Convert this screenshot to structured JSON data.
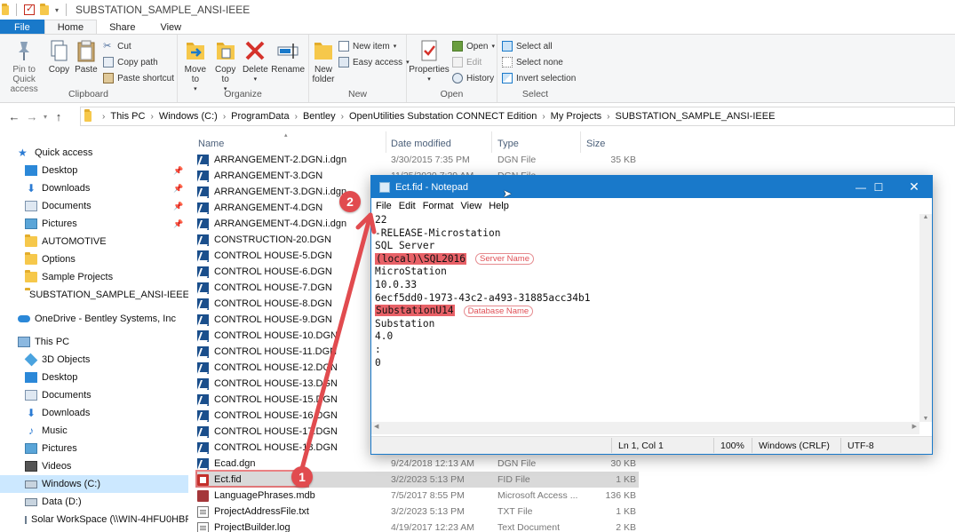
{
  "window": {
    "title": "SUBSTATION_SAMPLE_ANSI-IEEE"
  },
  "ribbon": {
    "tabs": [
      "File",
      "Home",
      "Share",
      "View"
    ],
    "clipboard": {
      "pin_label": "Pin to Quick access",
      "copy_label": "Copy",
      "paste_label": "Paste",
      "cut_label": "Cut",
      "copy_path_label": "Copy path",
      "paste_shortcut_label": "Paste shortcut",
      "group_label": "Clipboard"
    },
    "organize": {
      "move_to_label": "Move to",
      "copy_to_label": "Copy to",
      "delete_label": "Delete",
      "rename_label": "Rename",
      "group_label": "Organize"
    },
    "new": {
      "new_folder_label": "New folder",
      "new_item_label": "New item",
      "easy_access_label": "Easy access",
      "group_label": "New"
    },
    "open": {
      "properties_label": "Properties",
      "open_label": "Open",
      "edit_label": "Edit",
      "history_label": "History",
      "group_label": "Open"
    },
    "select": {
      "select_all_label": "Select all",
      "select_none_label": "Select none",
      "invert_label": "Invert selection",
      "group_label": "Select"
    }
  },
  "address": {
    "crumbs": [
      "This PC",
      "Windows (C:)",
      "ProgramData",
      "Bentley",
      "OpenUtilities Substation CONNECT Edition",
      "My Projects",
      "SUBSTATION_SAMPLE_ANSI-IEEE"
    ]
  },
  "sidebar": {
    "quick_access": "Quick access",
    "qa_items": [
      "Desktop",
      "Downloads",
      "Documents",
      "Pictures",
      "AUTOMOTIVE",
      "Options",
      "Sample Projects",
      "SUBSTATION_SAMPLE_ANSI-IEEE"
    ],
    "onedrive": "OneDrive - Bentley Systems, Inc",
    "this_pc": "This PC",
    "pc_items": [
      "3D Objects",
      "Desktop",
      "Documents",
      "Downloads",
      "Music",
      "Pictures",
      "Videos",
      "Windows (C:)",
      "Data (D:)",
      "Solar WorkSpace (\\\\WIN-4HFU0HBP("
    ]
  },
  "filelist": {
    "headers": {
      "name": "Name",
      "date": "Date modified",
      "type": "Type",
      "size": "Size"
    },
    "rows": [
      {
        "name": "ARRANGEMENT-2.DGN.i.dgn",
        "date": "3/30/2015 7:35 PM",
        "type": "DGN File",
        "size": "35 KB",
        "icon": "dgn"
      },
      {
        "name": "ARRANGEMENT-3.DGN",
        "date": "11/25/2020 7:39 AM",
        "type": "DGN File",
        "size": "",
        "icon": "dgn"
      },
      {
        "name": "ARRANGEMENT-3.DGN.i.dgn",
        "date": "",
        "type": "",
        "size": "",
        "icon": "dgn"
      },
      {
        "name": "ARRANGEMENT-4.DGN",
        "date": "",
        "type": "",
        "size": "",
        "icon": "dgn"
      },
      {
        "name": "ARRANGEMENT-4.DGN.i.dgn",
        "date": "",
        "type": "",
        "size": "",
        "icon": "dgn"
      },
      {
        "name": "CONSTRUCTION-20.DGN",
        "date": "",
        "type": "",
        "size": "",
        "icon": "dgn"
      },
      {
        "name": "CONTROL HOUSE-5.DGN",
        "date": "",
        "type": "",
        "size": "",
        "icon": "dgn"
      },
      {
        "name": "CONTROL HOUSE-6.DGN",
        "date": "",
        "type": "",
        "size": "",
        "icon": "dgn"
      },
      {
        "name": "CONTROL HOUSE-7.DGN",
        "date": "",
        "type": "",
        "size": "",
        "icon": "dgn"
      },
      {
        "name": "CONTROL HOUSE-8.DGN",
        "date": "",
        "type": "",
        "size": "",
        "icon": "dgn"
      },
      {
        "name": "CONTROL HOUSE-9.DGN",
        "date": "",
        "type": "",
        "size": "",
        "icon": "dgn"
      },
      {
        "name": "CONTROL HOUSE-10.DGN",
        "date": "",
        "type": "",
        "size": "",
        "icon": "dgn"
      },
      {
        "name": "CONTROL HOUSE-11.DGN",
        "date": "",
        "type": "",
        "size": "",
        "icon": "dgn"
      },
      {
        "name": "CONTROL HOUSE-12.DGN",
        "date": "",
        "type": "",
        "size": "",
        "icon": "dgn"
      },
      {
        "name": "CONTROL HOUSE-13.DGN",
        "date": "",
        "type": "",
        "size": "",
        "icon": "dgn"
      },
      {
        "name": "CONTROL HOUSE-15.DGN",
        "date": "",
        "type": "",
        "size": "",
        "icon": "dgn"
      },
      {
        "name": "CONTROL HOUSE-16.DGN",
        "date": "",
        "type": "",
        "size": "",
        "icon": "dgn"
      },
      {
        "name": "CONTROL HOUSE-17.DGN",
        "date": "",
        "type": "",
        "size": "",
        "icon": "dgn"
      },
      {
        "name": "CONTROL HOUSE-18.DGN",
        "date": "",
        "type": "",
        "size": "",
        "icon": "dgn"
      },
      {
        "name": "Ecad.dgn",
        "date": "9/24/2018 12:13 AM",
        "type": "DGN File",
        "size": "30 KB",
        "icon": "dgn"
      },
      {
        "name": "Ect.fid",
        "date": "3/2/2023 5:13 PM",
        "type": "FID File",
        "size": "1 KB",
        "icon": "fid",
        "selected": true
      },
      {
        "name": "LanguagePhrases.mdb",
        "date": "7/5/2017 8:55 PM",
        "type": "Microsoft Access ...",
        "size": "136 KB",
        "icon": "mdb"
      },
      {
        "name": "ProjectAddressFile.txt",
        "date": "3/2/2023 5:13 PM",
        "type": "TXT File",
        "size": "1 KB",
        "icon": "txt"
      },
      {
        "name": "ProjectBuilder.log",
        "date": "4/19/2017 12:23 AM",
        "type": "Text Document",
        "size": "2 KB",
        "icon": "txt"
      }
    ]
  },
  "notepad": {
    "title": "Ect.fid - Notepad",
    "menu": [
      "File",
      "Edit",
      "Format",
      "View",
      "Help"
    ],
    "lines": [
      "22",
      "-RELEASE-Microstation",
      "SQL Server",
      "(local)\\SQL2016",
      "MicroStation",
      "10.0.33",
      "6ecf5dd0-1973-43c2-a493-31885acc34b1",
      "SubstationU14",
      "Substation",
      "4.0",
      ":",
      "0"
    ],
    "annotations": {
      "server": "Server Name",
      "database": "Database Name"
    },
    "status": {
      "position": "Ln 1, Col 1",
      "zoom": "100%",
      "eol": "Windows (CRLF)",
      "encoding": "UTF-8"
    }
  },
  "callouts": [
    "1",
    "2"
  ],
  "colors": {
    "accent": "#1979ca",
    "highlight": "#e86167",
    "callout": "#e14b4f"
  }
}
